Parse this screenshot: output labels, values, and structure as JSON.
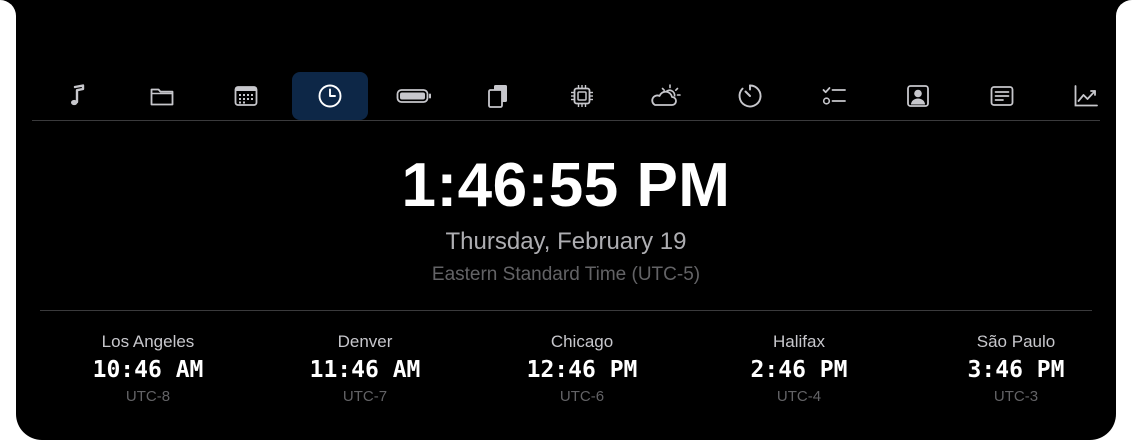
{
  "toolbar": {
    "items": [
      {
        "id": "music",
        "icon": "music-note-icon",
        "active": false
      },
      {
        "id": "files",
        "icon": "folder-icon",
        "active": false
      },
      {
        "id": "calendar",
        "icon": "calendar-icon",
        "active": false
      },
      {
        "id": "clock",
        "icon": "clock-icon",
        "active": true
      },
      {
        "id": "battery",
        "icon": "battery-icon",
        "active": false
      },
      {
        "id": "documents",
        "icon": "documents-icon",
        "active": false
      },
      {
        "id": "cpu",
        "icon": "cpu-icon",
        "active": false
      },
      {
        "id": "weather",
        "icon": "weather-icon",
        "active": false
      },
      {
        "id": "timer",
        "icon": "timer-icon",
        "active": false
      },
      {
        "id": "checklist",
        "icon": "checklist-icon",
        "active": false
      },
      {
        "id": "contacts",
        "icon": "contact-icon",
        "active": false
      },
      {
        "id": "news",
        "icon": "news-icon",
        "active": false
      },
      {
        "id": "stocks",
        "icon": "chart-line-icon",
        "active": false
      }
    ],
    "active_color": "#0d2747"
  },
  "clock": {
    "time": "1:46:55 PM",
    "date": "Thursday, February 19",
    "timezone": "Eastern Standard Time (UTC-5)"
  },
  "world_clocks": [
    {
      "city": "Los Angeles",
      "time": "10:46 AM",
      "offset": "UTC-8"
    },
    {
      "city": "Denver",
      "time": "11:46 AM",
      "offset": "UTC-7"
    },
    {
      "city": "Chicago",
      "time": "12:46 PM",
      "offset": "UTC-6"
    },
    {
      "city": "Halifax",
      "time": "2:46 PM",
      "offset": "UTC-4"
    },
    {
      "city": "São Paulo",
      "time": "3:46 PM",
      "offset": "UTC-3"
    }
  ]
}
